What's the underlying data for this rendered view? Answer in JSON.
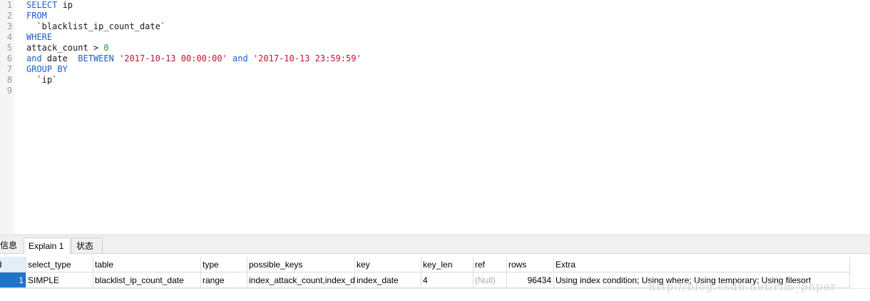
{
  "editor": {
    "lines": [
      {
        "num": "1",
        "parts": [
          {
            "t": "SELECT",
            "c": "kw"
          },
          {
            "t": " ip",
            "c": "plain"
          }
        ]
      },
      {
        "num": "2",
        "parts": [
          {
            "t": "FROM",
            "c": "kw"
          }
        ]
      },
      {
        "num": "3",
        "parts": [
          {
            "t": "  `blacklist_ip_count_date`",
            "c": "plain"
          }
        ]
      },
      {
        "num": "4",
        "parts": [
          {
            "t": "WHERE",
            "c": "kw"
          }
        ]
      },
      {
        "num": "5",
        "parts": [
          {
            "t": "attack_count > ",
            "c": "plain"
          },
          {
            "t": "0",
            "c": "num"
          }
        ]
      },
      {
        "num": "6",
        "parts": [
          {
            "t": "and",
            "c": "kw"
          },
          {
            "t": " date  ",
            "c": "plain"
          },
          {
            "t": "BETWEEN",
            "c": "kw"
          },
          {
            "t": " ",
            "c": "plain"
          },
          {
            "t": "'2017-10-13 00:00:00'",
            "c": "str"
          },
          {
            "t": " ",
            "c": "plain"
          },
          {
            "t": "and",
            "c": "kw"
          },
          {
            "t": " ",
            "c": "plain"
          },
          {
            "t": "'2017-10-13 23:59:59'",
            "c": "str"
          }
        ]
      },
      {
        "num": "7",
        "parts": [
          {
            "t": "GROUP BY",
            "c": "kw"
          }
        ]
      },
      {
        "num": "8",
        "parts": [
          {
            "t": "  `ip`",
            "c": "plain"
          }
        ]
      },
      {
        "num": "9",
        "parts": []
      }
    ]
  },
  "tabs": {
    "info": "信息",
    "explain": "Explain 1",
    "status": "状态"
  },
  "grid": {
    "columns": [
      "id",
      "select_type",
      "table",
      "type",
      "possible_keys",
      "key",
      "key_len",
      "ref",
      "rows",
      "Extra"
    ],
    "row": {
      "id": "1",
      "select_type": "SIMPLE",
      "table": "blacklist_ip_count_date",
      "type": "range",
      "possible_keys": "index_attack_count,index_date",
      "key": "index_date",
      "key_len": "4",
      "ref": "(Null)",
      "rows": "96434",
      "extra": "Using index condition; Using where; Using temporary; Using filesort"
    }
  },
  "watermark": "http://blog.csdn.net/rim_phper",
  "colors": {
    "keyword": "#1d5ec9",
    "number": "#1b9e3a",
    "string": "#c8102e",
    "selected_cell": "#1e74c8"
  }
}
